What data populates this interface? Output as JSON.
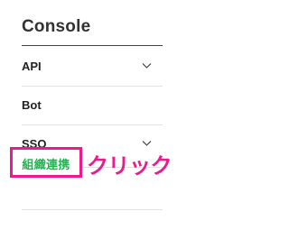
{
  "sidebar": {
    "title": "Console",
    "items": [
      {
        "label": "API",
        "icon": "chevron-down-icon",
        "expandable": true
      },
      {
        "label": "Bot",
        "expandable": false
      },
      {
        "label": "SSO",
        "icon": "chevron-down-icon",
        "expandable": true
      },
      {
        "label": "組織連携",
        "highlighted": true
      }
    ]
  },
  "annotation": {
    "text": "クリック",
    "color": "#ec1b8c"
  },
  "colors": {
    "highlight_border": "#ec1b8c",
    "active_link": "#1fb64f",
    "heading_rule": "#444444",
    "divider": "#e2e2e2"
  }
}
